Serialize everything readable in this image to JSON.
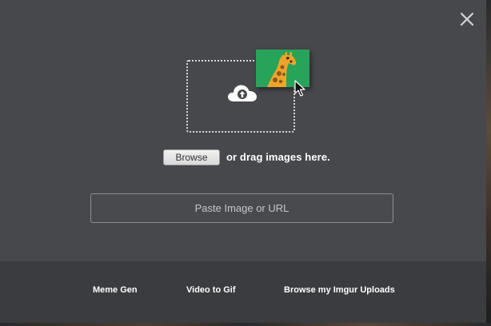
{
  "modal": {
    "close_label": "×",
    "icons": {
      "close": "close-icon",
      "upload": "cloud-upload-icon",
      "preview": "giraffe-image-icon",
      "cursor": "mouse-cursor-icon"
    },
    "colors": {
      "modal_bg": "#47484c",
      "footer_bg": "#3b3c40",
      "preview_green": "#27a35a"
    }
  },
  "upload": {
    "browse_label": "Browse",
    "drag_text": "or drag images here.",
    "url_placeholder": "Paste Image or URL",
    "url_value": ""
  },
  "footer": {
    "links": [
      {
        "label": "Meme Gen"
      },
      {
        "label": "Video to Gif"
      },
      {
        "label": "Browse my Imgur Uploads"
      }
    ]
  }
}
